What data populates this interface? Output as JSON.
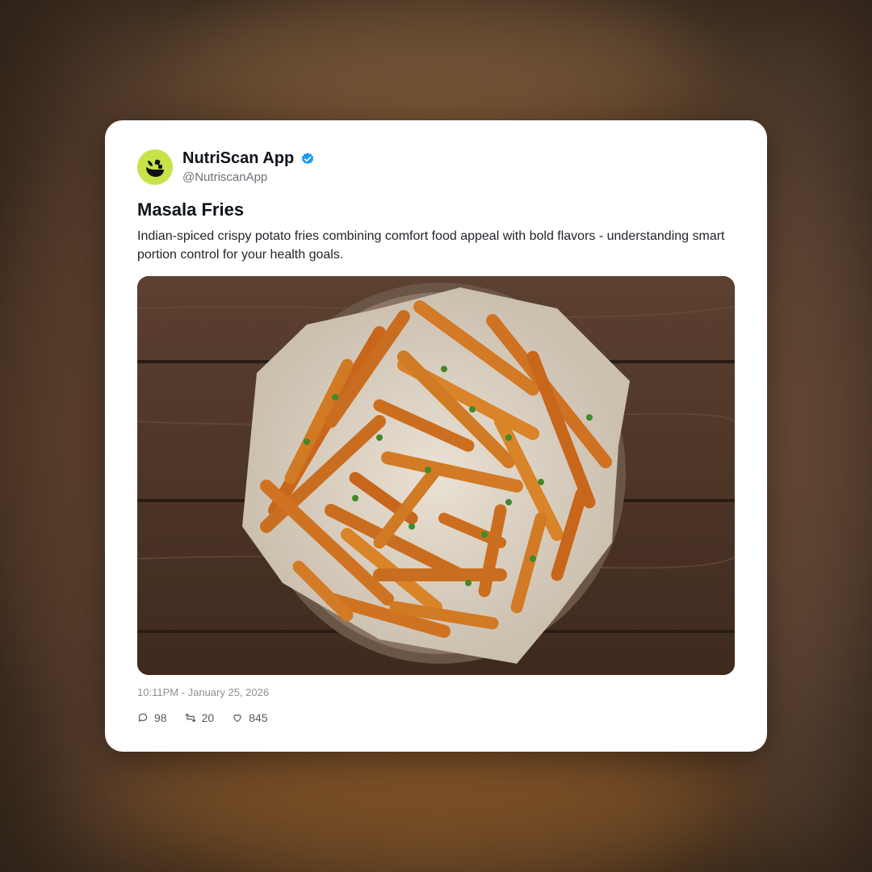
{
  "account": {
    "name": "NutriScan App",
    "handle": "@NutriscanApp",
    "verified": true,
    "avatar_color": "#c6e34a"
  },
  "post": {
    "title": "Masala Fries",
    "description": "Indian-spiced crispy potato fries combining comfort food appeal with bold flavors - understanding smart portion control for your health goals.",
    "image_subject": "masala-fries-bowl-photo",
    "timestamp": "10:11PM - January 25, 2026"
  },
  "stats": {
    "replies": "98",
    "retweets": "20",
    "likes": "845"
  },
  "colors": {
    "verified_blue": "#1d9bf0",
    "card_bg": "#ffffff"
  }
}
